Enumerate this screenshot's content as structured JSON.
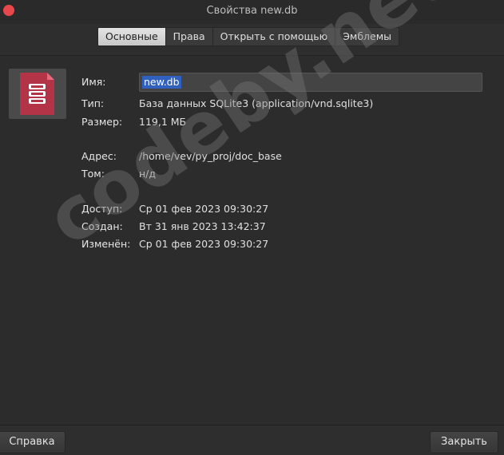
{
  "window": {
    "title": "Свойства new.db"
  },
  "tabs": [
    {
      "label": "Основные",
      "active": true
    },
    {
      "label": "Права"
    },
    {
      "label": "Открыть с помощью"
    },
    {
      "label": "Эмблемы"
    }
  ],
  "icon": {
    "name": "sqlite-database-file-icon",
    "color": "#c0392b"
  },
  "fields": {
    "name": {
      "label": "Имя:",
      "value": "new.db"
    },
    "type": {
      "label": "Тип:",
      "value": "База данных SQLite3 (application/vnd.sqlite3)"
    },
    "size": {
      "label": "Размер:",
      "value": "119,1 МБ"
    },
    "address": {
      "label": "Адрес:",
      "value": "/home/vev/py_proj/doc_base"
    },
    "volume": {
      "label": "Том:",
      "value": "н/д"
    },
    "accessed": {
      "label": "Доступ:",
      "value": "Ср 01 фев 2023 09:30:27"
    },
    "created": {
      "label": "Создан:",
      "value": "Вт 31 янв 2023 13:42:37"
    },
    "modified": {
      "label": "Изменён:",
      "value": "Ср 01 фев 2023 09:30:27"
    }
  },
  "watermark": "codeby.net",
  "buttons": {
    "help": "Справка",
    "close": "Закрыть"
  }
}
